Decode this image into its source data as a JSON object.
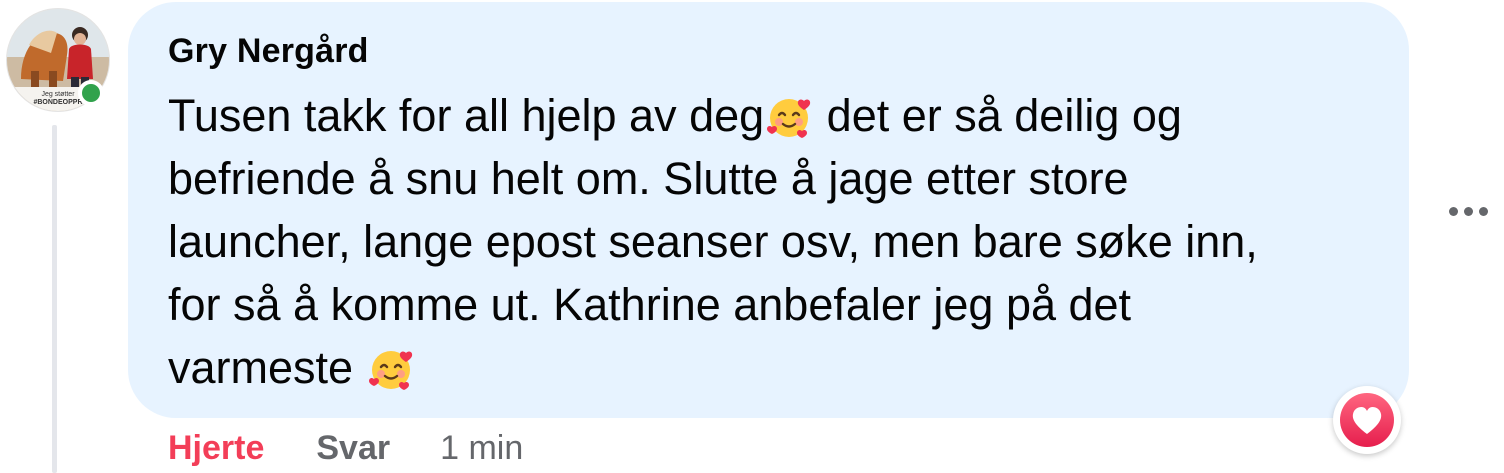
{
  "comment": {
    "author": "Gry Nergård",
    "avatar_caption": [
      "Jeg støtter",
      "#BONDEOPPR"
    ],
    "lines": [
      [
        "Tusen takk for all hjelp av deg",
        "smiling-face-with-hearts-icon",
        " det er så deilig og"
      ],
      [
        "befriende å snu helt om. Slutte å jage etter store"
      ],
      [
        "launcher, lange epost seanser osv, men bare søke inn,"
      ],
      [
        "for så å komme ut. Kathrine anbefaler jeg på det"
      ],
      [
        "varmeste ",
        "smiling-face-with-hearts-icon"
      ]
    ],
    "online": true
  },
  "actions": {
    "like_label": "Hjerte",
    "reply_label": "Svar",
    "timestamp": "1 min"
  },
  "reaction": {
    "type": "heart",
    "icon": "heart-icon"
  },
  "menu": {
    "icon": "more-options-icon"
  },
  "colors": {
    "bubble_bg": "#e7f3ff",
    "like_active": "#f33e58",
    "secondary_text": "#65676b",
    "online": "#31a24c"
  }
}
